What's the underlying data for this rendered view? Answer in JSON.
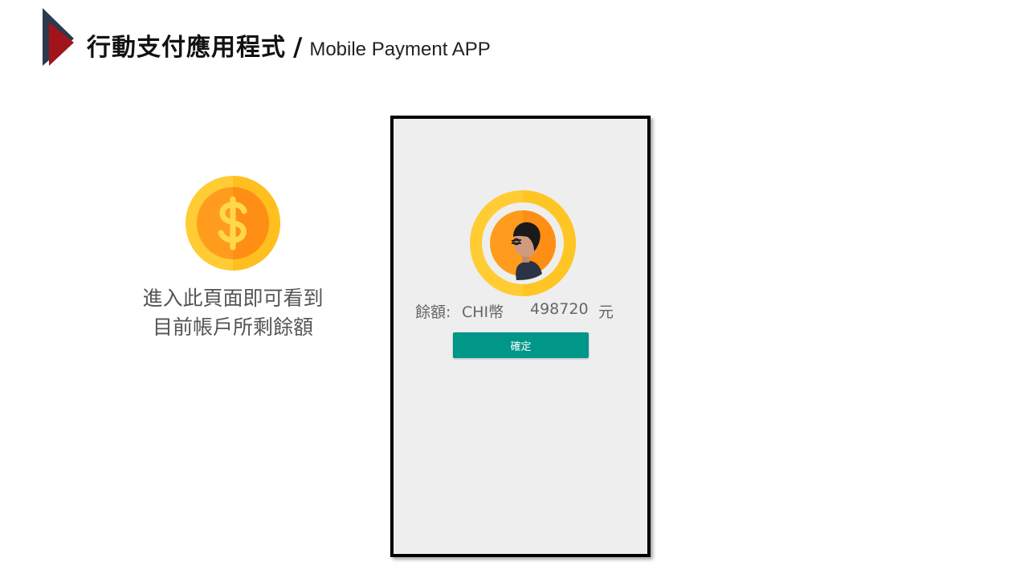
{
  "header": {
    "title_cn": "行動支付應用程式",
    "slash": "/",
    "title_en": "Mobile Payment APP",
    "icon": "triangle-arrow-icon"
  },
  "illustration": {
    "icon": "dollar-coin-icon",
    "caption_line1": "進入此頁面即可看到",
    "caption_line2": "目前帳戶所剩餘額"
  },
  "phone": {
    "avatar_icon": "user-avatar-icon",
    "balance_label": "餘額:",
    "currency_name": "CHI幣",
    "balance_amount": "498720",
    "balance_unit": "元",
    "confirm_label": "確定"
  },
  "colors": {
    "accent_button": "#009688",
    "coin_outer": "#FFCC33",
    "coin_inner": "#FF9C1E",
    "mark_red": "#A3141A",
    "mark_navy": "#2B3A4F",
    "phone_bg": "#EEEEEE"
  }
}
